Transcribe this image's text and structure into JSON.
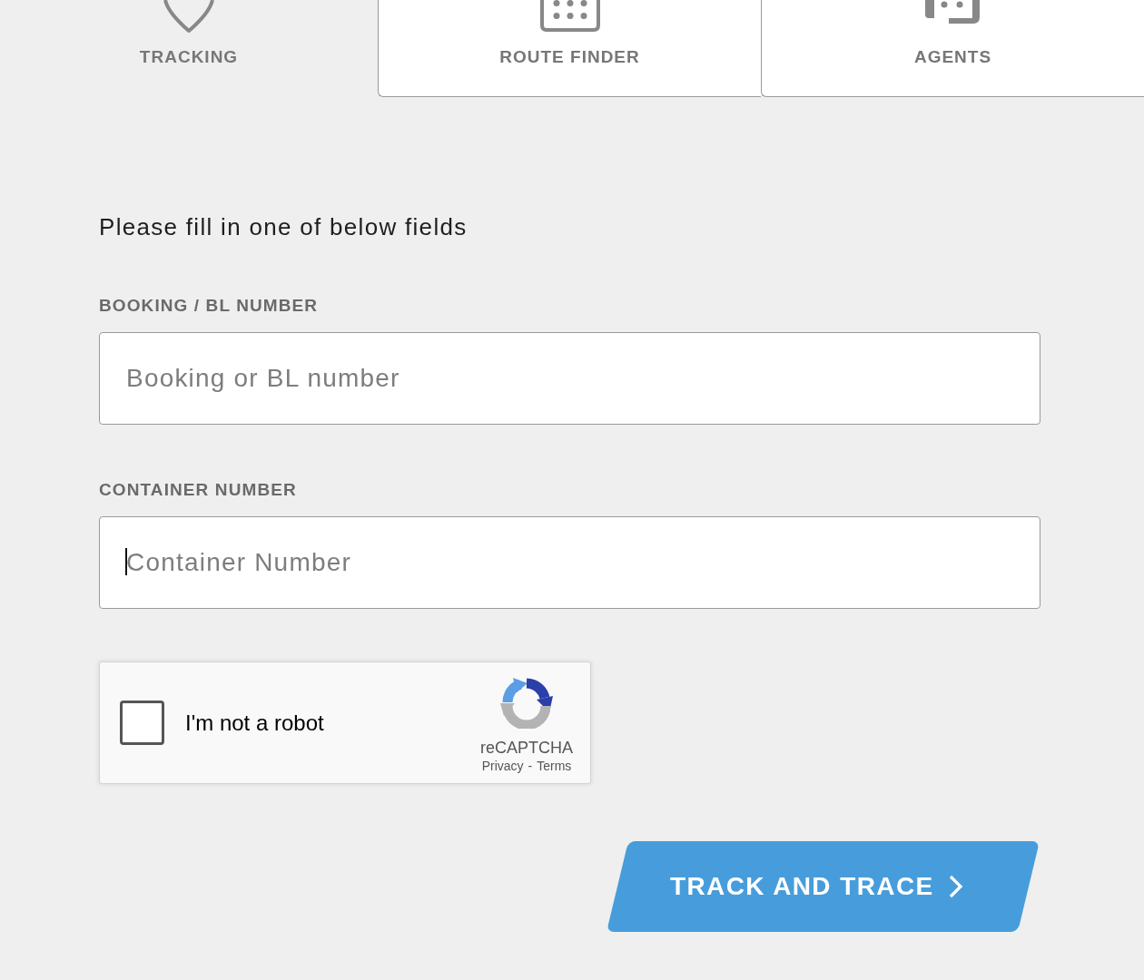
{
  "tabs": [
    {
      "label": "TRACKING",
      "selected": true
    },
    {
      "label": "ROUTE FINDER",
      "selected": false
    },
    {
      "label": "AGENTS",
      "selected": false
    }
  ],
  "form": {
    "instruction": "Please fill in one of below fields",
    "fields": [
      {
        "label": "BOOKING / BL NUMBER",
        "placeholder": "Booking or BL number",
        "focused": false
      },
      {
        "label": "CONTAINER NUMBER",
        "placeholder": "Container Number",
        "focused": true
      }
    ]
  },
  "captcha": {
    "label": "I'm not a robot",
    "checked": false,
    "brand": "reCAPTCHA",
    "links": [
      "Privacy",
      "Terms"
    ],
    "separator": "-"
  },
  "submit": {
    "label": "TRACK AND TRACE"
  }
}
